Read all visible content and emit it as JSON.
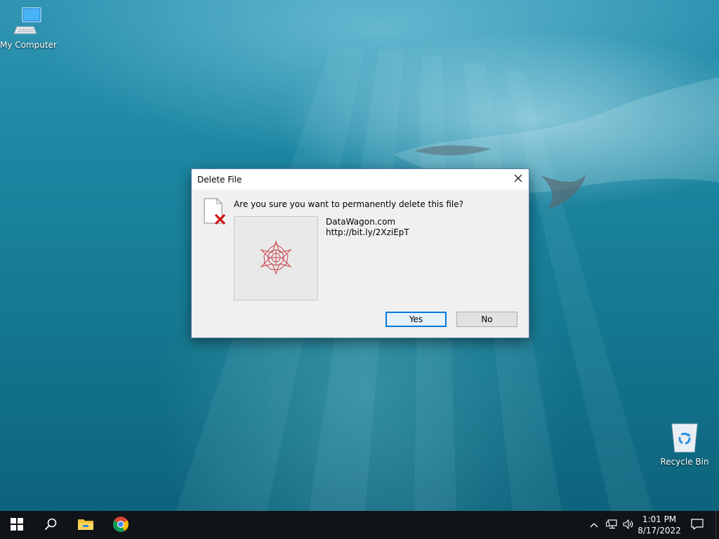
{
  "desktop": {
    "icons": [
      {
        "label": "My Computer",
        "icon": "computer-icon"
      },
      {
        "label": "Recycle Bin",
        "icon": "recycle-bin-icon"
      }
    ]
  },
  "dialog": {
    "title": "Delete File",
    "question": "Are you sure you want to permanently delete this file?",
    "file_name": "DataWagon.com",
    "file_url": "http://bit.ly/2XziEpT",
    "yes_label": "Yes",
    "no_label": "No",
    "icons": {
      "close": "close-icon",
      "file": "file-delete-icon",
      "preview": "star-mandala-icon"
    }
  },
  "taskbar": {
    "apps": [
      "start-icon",
      "search-icon",
      "file-explorer-icon",
      "chrome-icon"
    ],
    "tray_icons": [
      "chevron-up-icon",
      "network-icon",
      "volume-icon",
      "notification-icon"
    ],
    "time": "1:01 PM",
    "date": "8/17/2022"
  },
  "colors": {
    "accent": "#0078d7",
    "taskbar": "#101418",
    "dialog_bg": "#f0f0f0",
    "delete_x": "#cc1414"
  }
}
